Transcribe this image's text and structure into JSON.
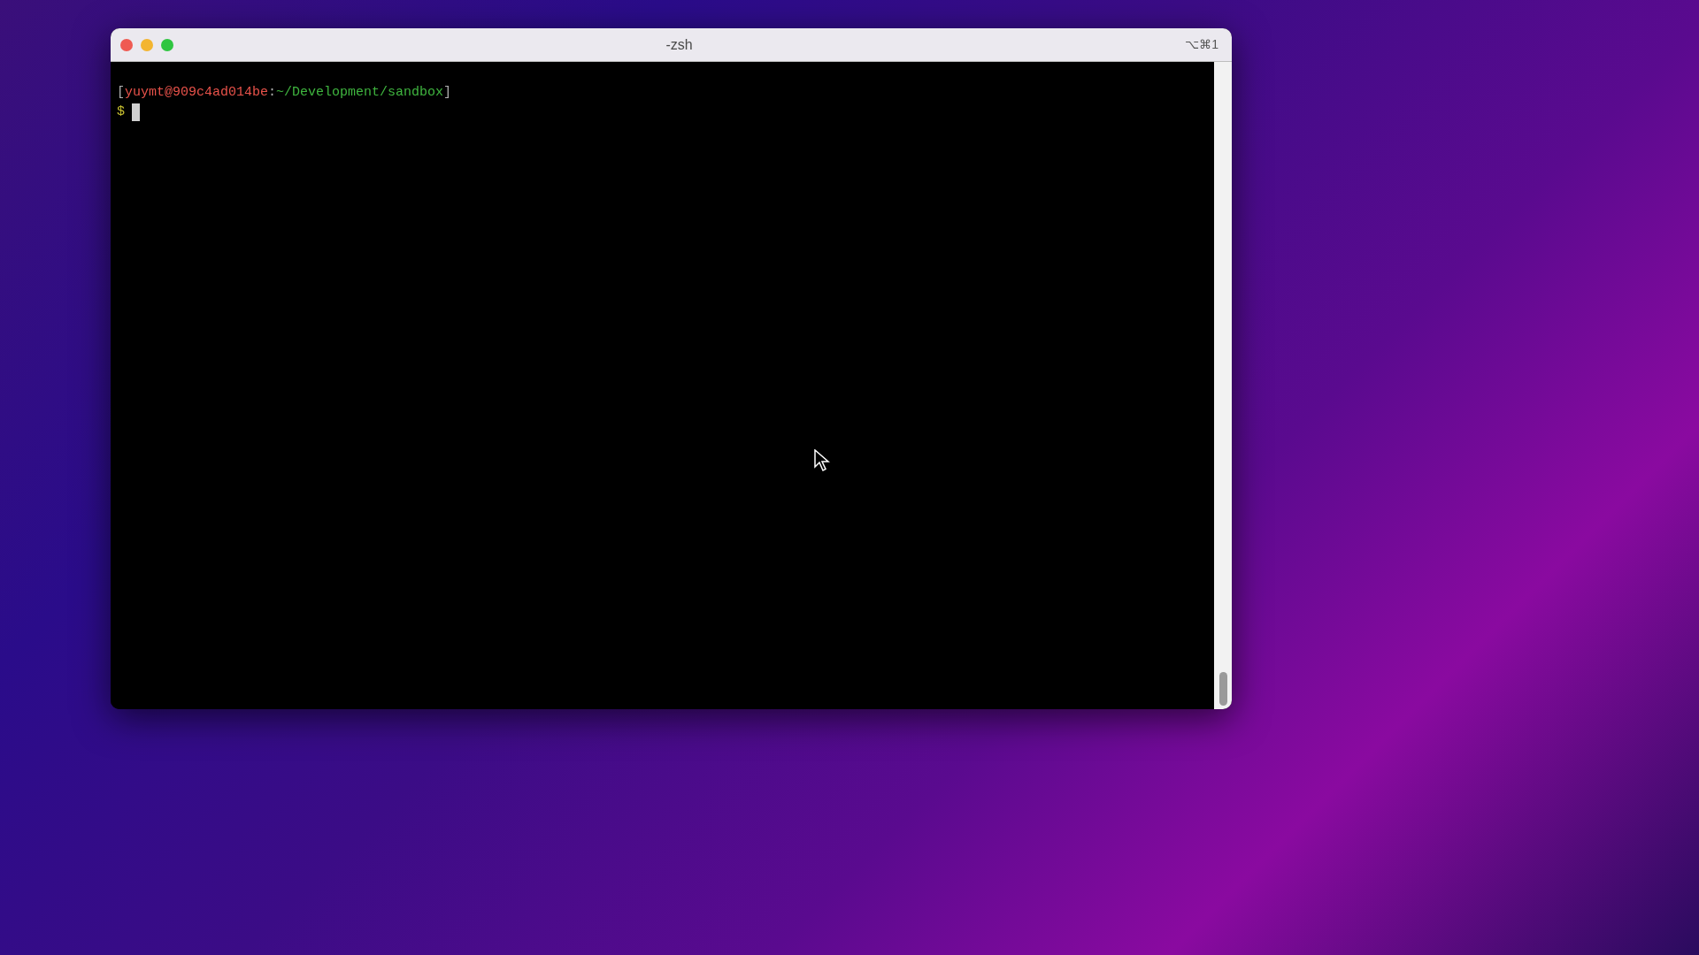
{
  "window": {
    "title": "-zsh",
    "shortcut": "⌥⌘1"
  },
  "terminal": {
    "prompt_open": "[",
    "user_host": "yuymt@909c4ad014be",
    "separator": ":",
    "path": "~/Development/sandbox",
    "prompt_close": "]",
    "symbol": "$",
    "cursor_visible": true
  }
}
